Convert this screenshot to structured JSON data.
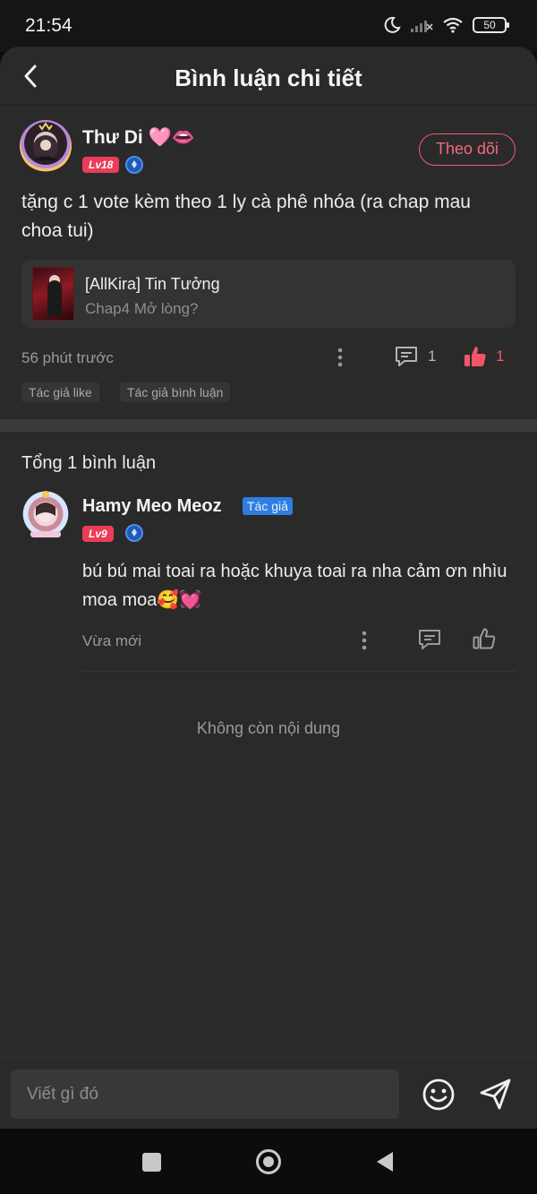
{
  "status_bar": {
    "time": "21:54",
    "battery": "50"
  },
  "header": {
    "title": "Bình luận chi tiết"
  },
  "post": {
    "author_name": "Thư Di 🩷👄",
    "level": "Lv18",
    "follow_label": "Theo dõi",
    "text": "tặng c 1 vote kèm theo 1 ly cà phê nhóa (ra chap mau choa tui)",
    "chapter": {
      "title": "[AllKira] Tin Tưởng",
      "subtitle": "Chap4 Mở lòng?"
    },
    "time": "56 phút trước",
    "reply_count": "1",
    "like_count": "1",
    "tags": [
      "Tác giả like",
      "Tác giả bình luận"
    ]
  },
  "replies_header": "Tổng 1 bình luận",
  "reply": {
    "author_name": "Hamy Meo Meoz",
    "author_badge": "Tác giả",
    "level": "Lv9",
    "text": "bú bú mai toai ra hoặc khuya toai ra nha cảm ơn nhìu moa moa🥰💓",
    "time": "Vừa mới"
  },
  "end_text": "Không còn nội dung",
  "composer": {
    "placeholder": "Viết gì đó"
  },
  "icons": {
    "back": "chevron-left-icon",
    "more": "more-vertical-icon",
    "reply": "comment-icon",
    "like": "thumbs-up-icon",
    "emoji": "smiley-icon",
    "send": "send-icon"
  },
  "colors": {
    "accent": "#f05a6e",
    "author_badge": "#2f7de0",
    "level_badge": "#ea3d57",
    "background": "#2a2a2a"
  }
}
